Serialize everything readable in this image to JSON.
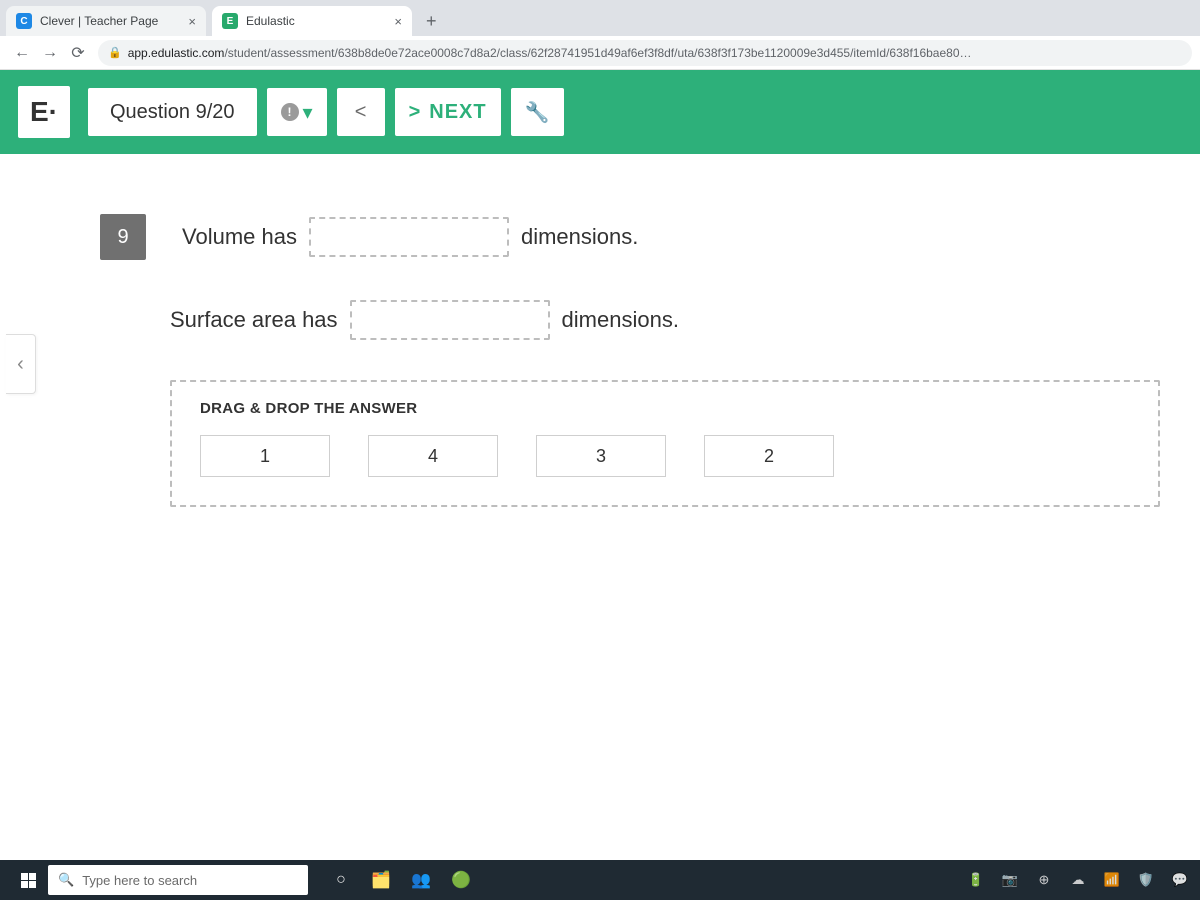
{
  "browser": {
    "tabs": [
      {
        "favicon_letter": "C",
        "title": "Clever | Teacher Page"
      },
      {
        "favicon_letter": "E",
        "title": "Edulastic"
      }
    ],
    "url_host": "app.edulastic.com",
    "url_path": "/student/assessment/638b8de0e72ace0008c7d8a2/class/62f28741951d49af6ef3f8df/uta/638f3f173be1120009e3d455/itemId/638f16bae80…"
  },
  "header": {
    "logo": "E·",
    "question_label": "Question 9/20",
    "prev_symbol": "<",
    "next_symbol": ">",
    "next_label": "NEXT"
  },
  "question": {
    "number": "9",
    "line1_before": "Volume has",
    "line1_after": "dimensions.",
    "line2_before": "Surface area has",
    "line2_after": "dimensions.",
    "bank_title": "DRAG & DROP THE ANSWER",
    "choices": [
      "1",
      "4",
      "3",
      "2"
    ]
  },
  "taskbar": {
    "search_placeholder": "Type here to search"
  }
}
